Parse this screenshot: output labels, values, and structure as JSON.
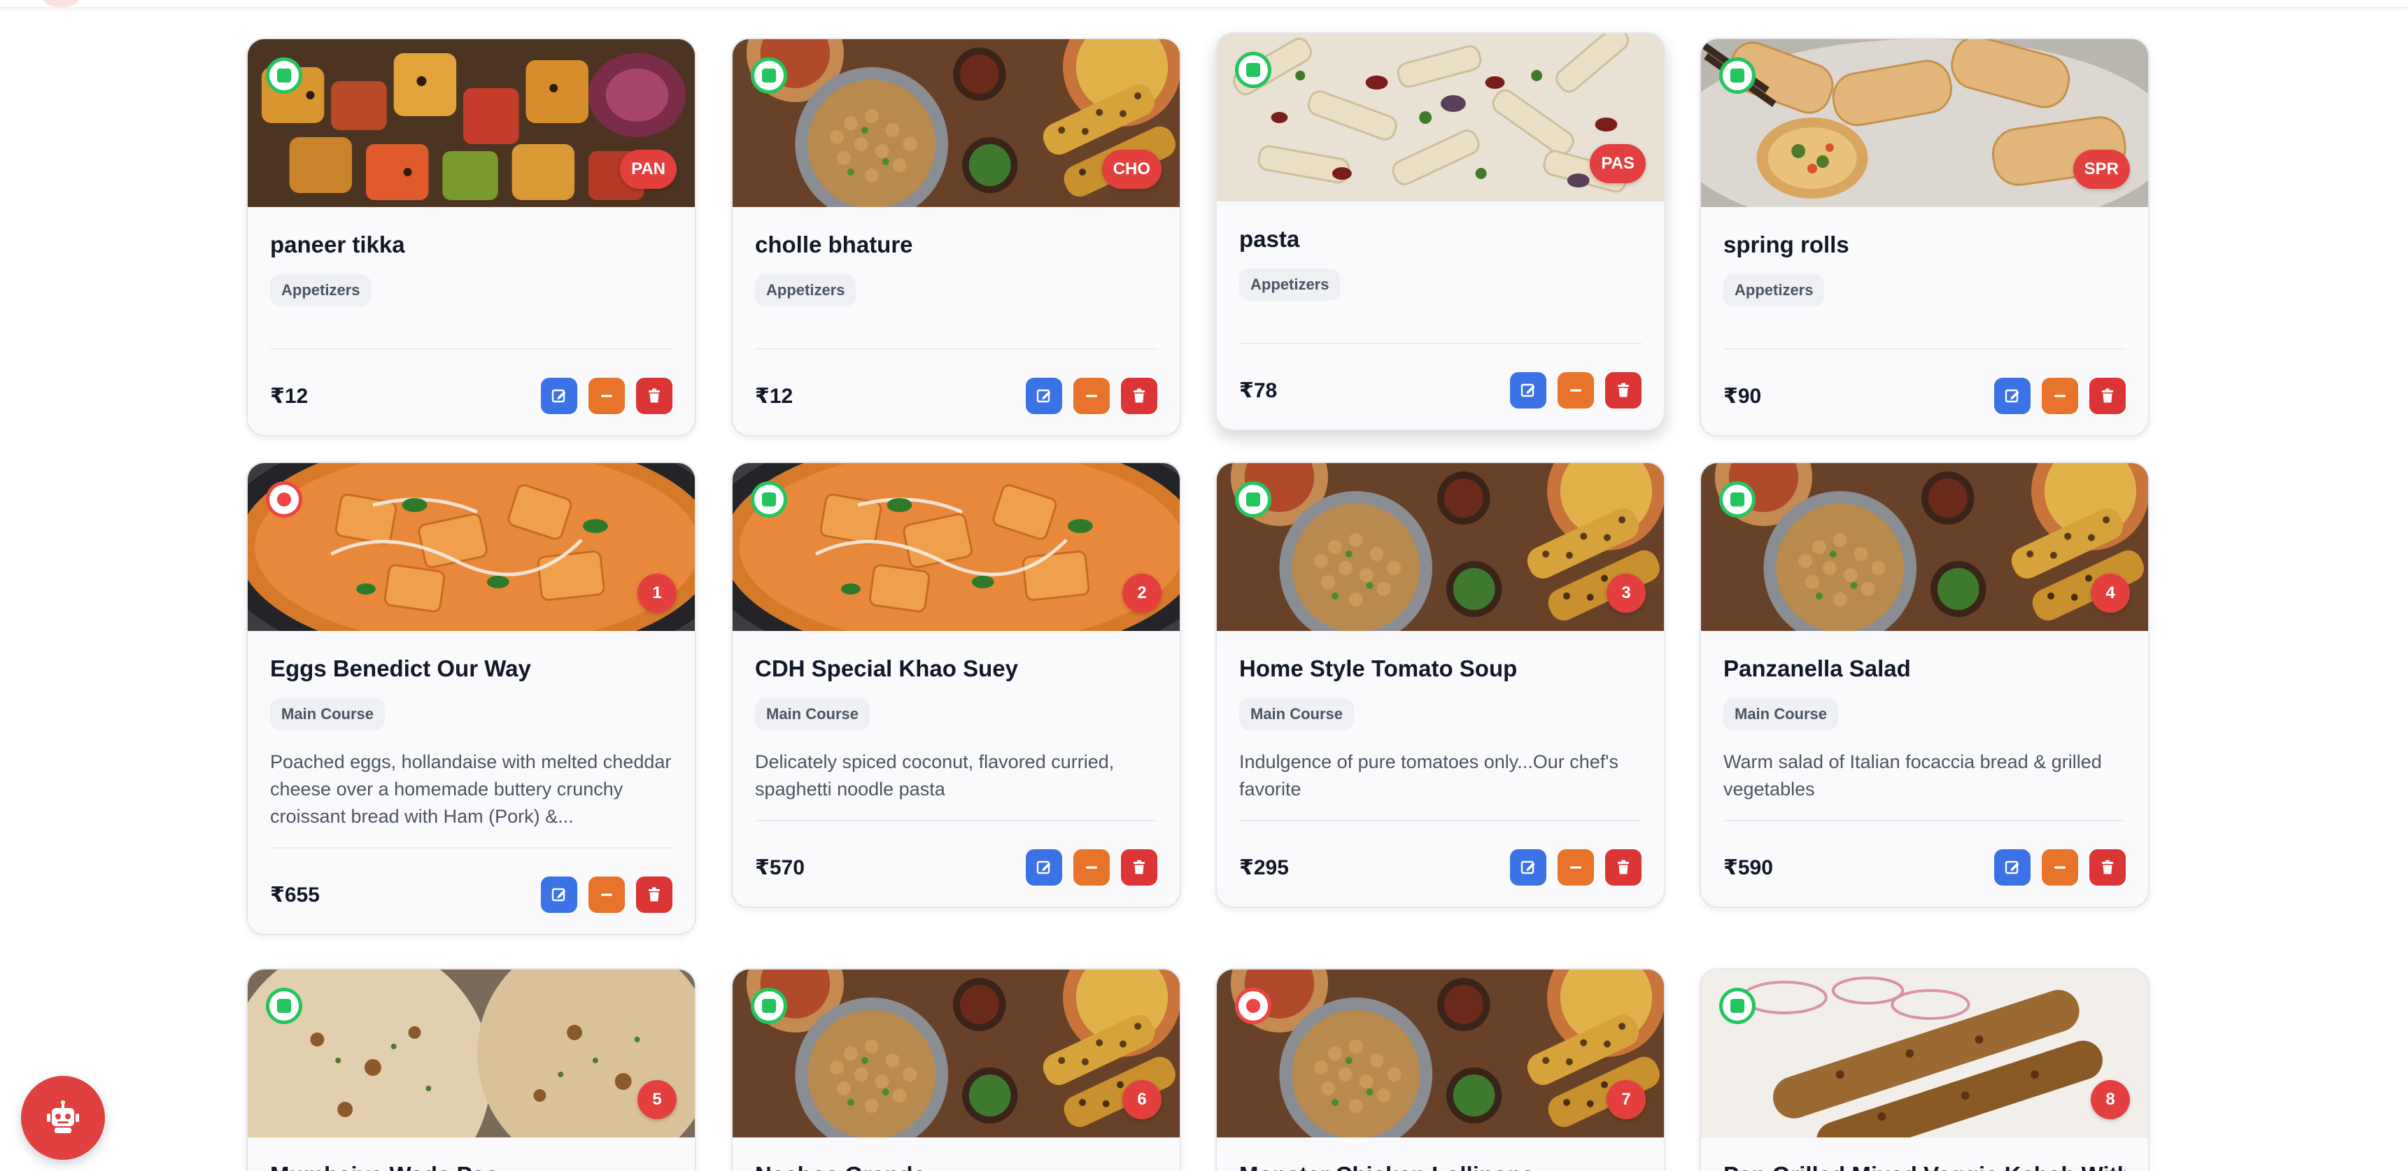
{
  "actions": {
    "edit_label": "Edit",
    "toggle_label": "Mark unavailable",
    "delete_label": "Delete"
  },
  "colors": {
    "veg": "#22c55e",
    "nonveg": "#ef4444",
    "badge": "#e43f3f",
    "edit": "#3b72e5",
    "minus": "#e8732a",
    "delete": "#dc3535"
  },
  "items": [
    {
      "name": "paneer tikka",
      "category": "Appetizers",
      "price": "₹12",
      "badge": "PAN",
      "diet": "veg",
      "image": "skewers",
      "description": ""
    },
    {
      "name": "cholle bhature",
      "category": "Appetizers",
      "price": "₹12",
      "badge": "CHO",
      "diet": "veg",
      "image": "platter",
      "description": ""
    },
    {
      "name": "pasta",
      "category": "Appetizers",
      "price": "₹78",
      "badge": "PAS",
      "diet": "veg",
      "image": "pasta",
      "description": ""
    },
    {
      "name": "spring rolls",
      "category": "Appetizers",
      "price": "₹90",
      "badge": "SPR",
      "diet": "veg",
      "image": "rolls",
      "description": ""
    },
    {
      "name": "Eggs Benedict Our Way",
      "category": "Main Course",
      "price": "₹655",
      "badge": "1",
      "diet": "nonveg",
      "image": "curry",
      "description": "Poached eggs, hollandaise with melted cheddar cheese over a homemade buttery crunchy croissant bread with Ham (Pork) &..."
    },
    {
      "name": "CDH Special Khao Suey",
      "category": "Main Course",
      "price": "₹570",
      "badge": "2",
      "diet": "veg",
      "image": "curry",
      "description": "Delicately spiced coconut, flavored curried, spaghetti noodle pasta"
    },
    {
      "name": "Home Style Tomato Soup",
      "category": "Main Course",
      "price": "₹295",
      "badge": "3",
      "diet": "veg",
      "image": "platter",
      "description": "Indulgence of pure tomatoes only...Our chef's favorite"
    },
    {
      "name": "Panzanella Salad",
      "category": "Main Course",
      "price": "₹590",
      "badge": "4",
      "diet": "veg",
      "image": "platter",
      "description": "Warm salad of Italian focaccia bread & grilled vegetables"
    },
    {
      "name": "Mumbaiya Wada Pao",
      "category": "",
      "price": "",
      "badge": "5",
      "diet": "veg",
      "image": "naan",
      "description": ""
    },
    {
      "name": "Nachos Grande",
      "category": "",
      "price": "",
      "badge": "6",
      "diet": "veg",
      "image": "platter",
      "description": ""
    },
    {
      "name": "Monster Chicken Lollipops",
      "category": "",
      "price": "",
      "badge": "7",
      "diet": "nonveg",
      "image": "platter",
      "description": ""
    },
    {
      "name": "Pan Grilled Mixed Veggie Kebab With",
      "category": "",
      "price": "",
      "badge": "8",
      "diet": "veg",
      "image": "kebab",
      "description": ""
    }
  ],
  "assistant": {
    "icon": "robot-icon"
  }
}
